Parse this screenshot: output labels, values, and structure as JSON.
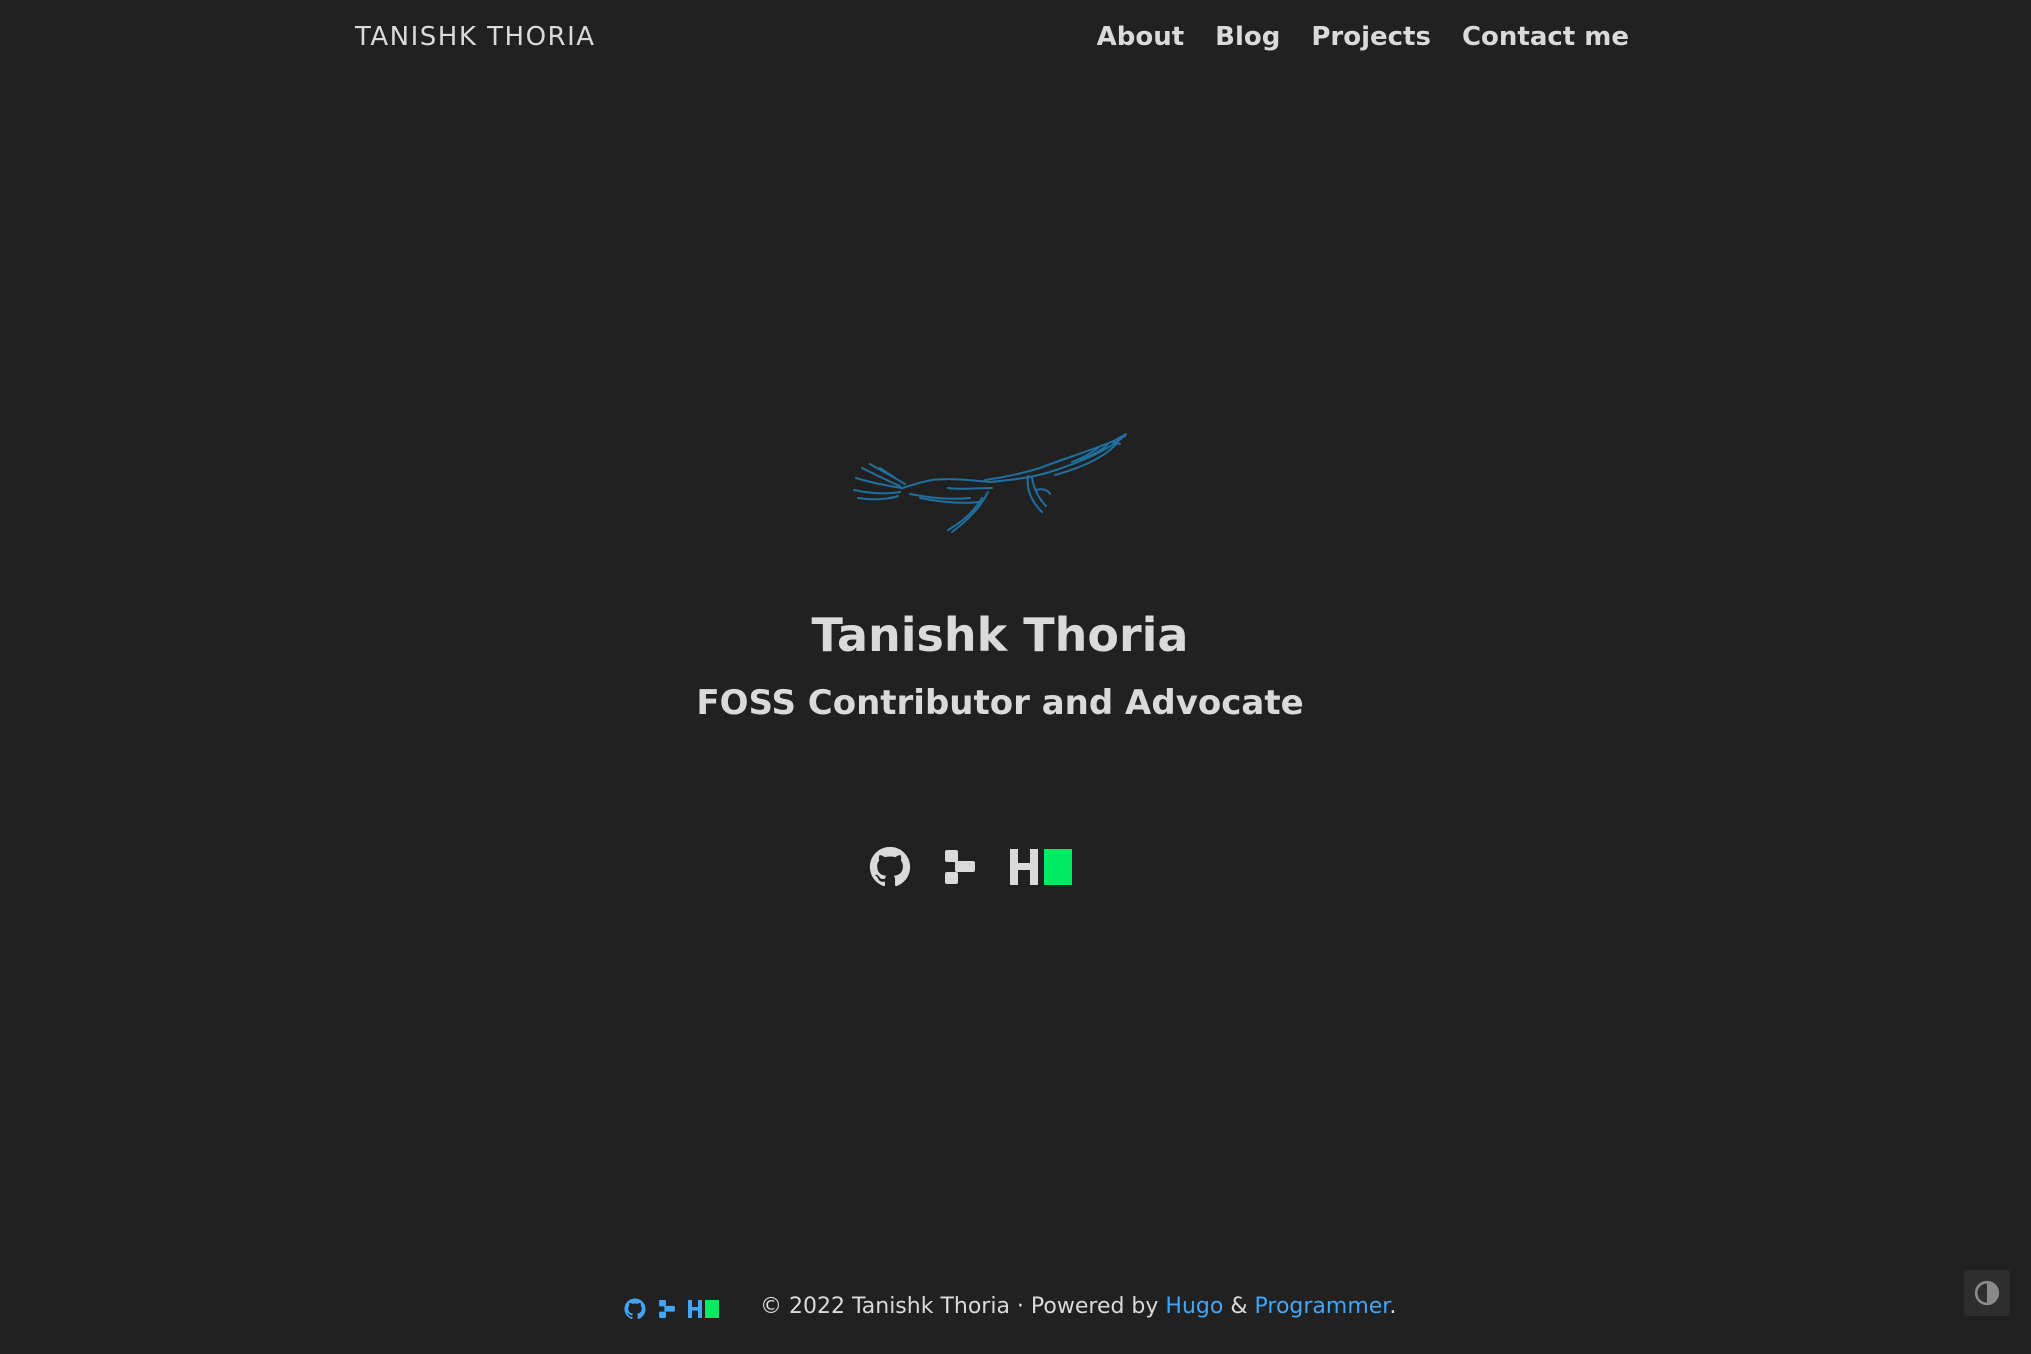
{
  "header": {
    "brand": "TANISHK THORIA",
    "nav": [
      {
        "label": "About"
      },
      {
        "label": "Blog"
      },
      {
        "label": "Projects"
      },
      {
        "label": "Contact me"
      }
    ]
  },
  "hero": {
    "logo_icon": "soaring-bird-logo",
    "title": "Tanishk Thoria",
    "subtitle": "FOSS Contributor and Advocate",
    "social": [
      {
        "icon": "github-icon"
      },
      {
        "icon": "gitlab-icon"
      },
      {
        "icon": "hackerrank-icon"
      }
    ]
  },
  "footer": {
    "social_icons": [
      "github-icon",
      "gitlab-icon",
      "hackerrank-icon"
    ],
    "copyright": "© 2022 Tanishk Thoria · Powered by",
    "hugo": "Hugo",
    "amp": "&",
    "programmer": "Programmer",
    "period": "."
  },
  "theme_toggle_icon": "contrast-icon",
  "colors": {
    "background": "#212121",
    "text": "#dadada",
    "link": "#42a5f5",
    "logo": "#1f6f9f",
    "hackerrank_green": "#00ea64"
  }
}
